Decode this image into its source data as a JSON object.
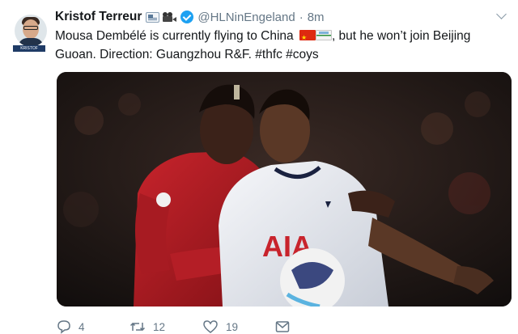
{
  "tweet": {
    "author_name": "Kristof Terreur",
    "author_emoji": [
      "newspaper-icon",
      "movie-camera-icon"
    ],
    "verified": true,
    "handle": "@HLNinEngeland",
    "separator": "·",
    "timestamp": "8m",
    "text_part1": "Mousa Dembélé is currently flying to China ",
    "text_flags": [
      "china-flag-icon",
      "hong-kong-flag-icon"
    ],
    "text_part2": ", but he won’t join Beijing Guoan. Direction: Guangzhou R&F. #thfc #coys",
    "avatar_banner": "KRISTOF TERREUR",
    "image": {
      "shirt_text": "AIA",
      "description": "football players"
    }
  },
  "actions": {
    "reply_count": "4",
    "retweet_count": "12",
    "like_count": "19"
  },
  "colors": {
    "accent": "#1da1f2",
    "secondary_text": "#657786",
    "primary_text": "#14171a"
  }
}
